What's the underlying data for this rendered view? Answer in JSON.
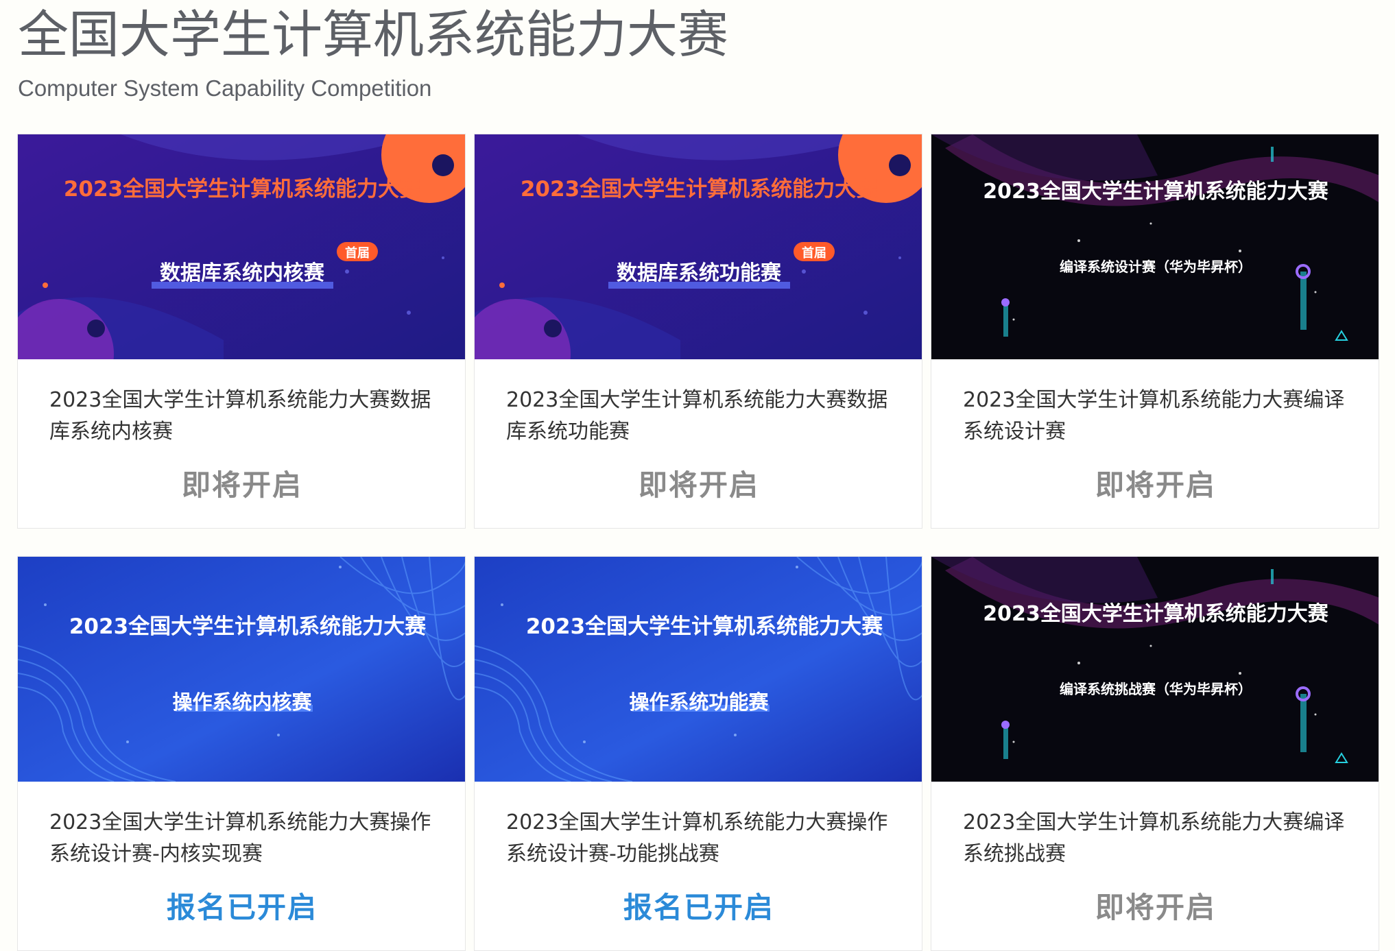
{
  "header": {
    "title": "全国大学生计算机系统能力大赛",
    "subtitle": "Computer System Capability Competition"
  },
  "cards": [
    {
      "banner_headline": "2023全国大学生计算机系统能力大赛",
      "banner_track": "数据库系统内核赛",
      "banner_badge": "首届",
      "title": "2023全国大学生计算机系统能力大赛数据库系统内核赛",
      "status": "即将开启",
      "theme": "purple-orange"
    },
    {
      "banner_headline": "2023全国大学生计算机系统能力大赛",
      "banner_track": "数据库系统功能赛",
      "banner_badge": "首届",
      "title": "2023全国大学生计算机系统能力大赛数据库系统功能赛",
      "status": "即将开启",
      "theme": "purple-orange"
    },
    {
      "banner_headline": "2023全国大学生计算机系统能力大赛",
      "banner_track": "编译系统设计赛（华为毕昇杯）",
      "title": "2023全国大学生计算机系统能力大赛编译系统设计赛",
      "status": "即将开启",
      "theme": "dark-space"
    },
    {
      "banner_headline": "2023全国大学生计算机系统能力大赛",
      "banner_track": "操作系统内核赛",
      "title": "2023全国大学生计算机系统能力大赛操作系统设计赛-内核实现赛",
      "status": "报名已开启",
      "theme": "blue-wave"
    },
    {
      "banner_headline": "2023全国大学生计算机系统能力大赛",
      "banner_track": "操作系统功能赛",
      "title": "2023全国大学生计算机系统能力大赛操作系统设计赛-功能挑战赛",
      "status": "报名已开启",
      "theme": "blue-wave"
    },
    {
      "banner_headline": "2023全国大学生计算机系统能力大赛",
      "banner_track": "编译系统挑战赛（华为毕昇杯）",
      "title": "2023全国大学生计算机系统能力大赛编译系统挑战赛",
      "status": "即将开启",
      "theme": "dark-space"
    }
  ],
  "colors": {
    "page_bg": "#fefefa",
    "status_soon": "#8a8a8a",
    "status_open": "#2b8ad8",
    "banner_orange_text": "#ff6d3a"
  }
}
